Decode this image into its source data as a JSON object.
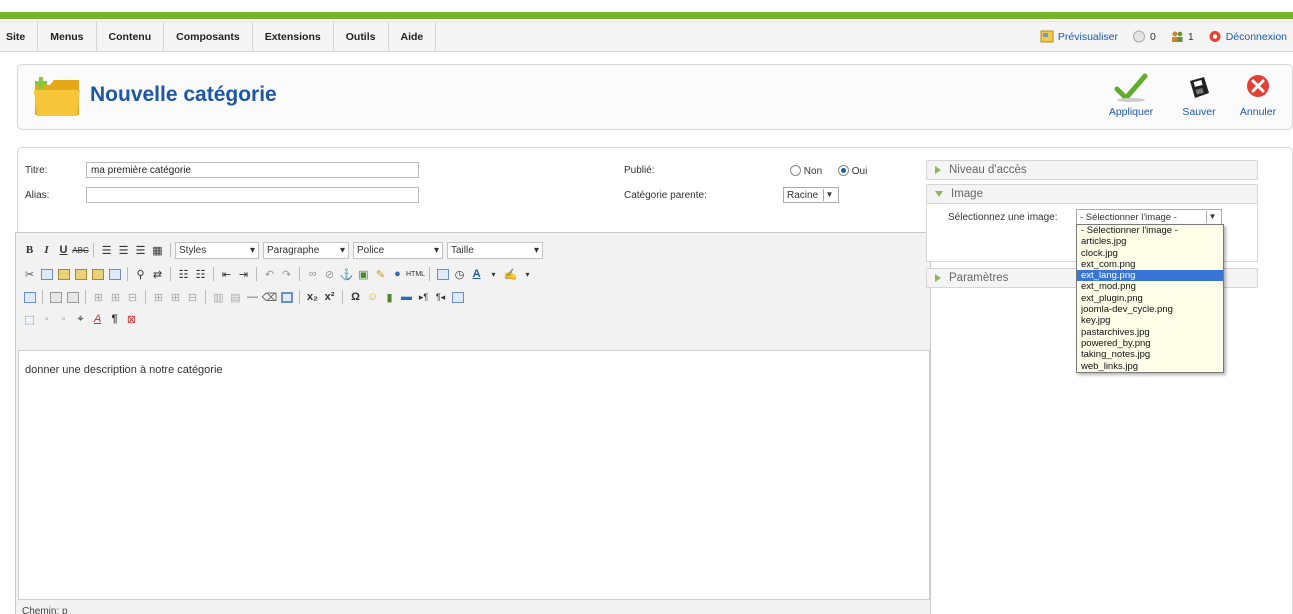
{
  "menubar": {
    "items": [
      "Site",
      "Menus",
      "Contenu",
      "Composants",
      "Extensions",
      "Outils",
      "Aide"
    ],
    "preview": "Prévisualiser",
    "messages_count": "0",
    "users_count": "1",
    "logout": "Déconnexion"
  },
  "header": {
    "title": "Nouvelle catégorie",
    "apply": "Appliquer",
    "save": "Sauver",
    "cancel": "Annuler"
  },
  "form": {
    "title_label": "Titre:",
    "title_value": "ma première catégorie",
    "alias_label": "Alias:",
    "alias_value": "",
    "published_label": "Publié:",
    "no_label": "Non",
    "yes_label": "Oui",
    "published": "Oui",
    "parent_label": "Catégorie parente:",
    "parent_value": "Racine"
  },
  "editor": {
    "styles": "Styles",
    "paragraph": "Paragraphe",
    "font": "Police",
    "size": "Taille",
    "content": "donner une description à notre catégorie",
    "path": "Chemin: p"
  },
  "sidebar": {
    "access": "Niveau d'accès",
    "image": "Image",
    "image_select_label": "Sélectionnez une image:",
    "image_select_value": "- Sélectionner l'image -",
    "params": "Paramètres",
    "image_options": [
      "- Sélectionner l'image -",
      "articles.jpg",
      "clock.jpg",
      "ext_com.png",
      "ext_lang.png",
      "ext_mod.png",
      "ext_plugin.png",
      "joomla-dev_cycle.png",
      "key.jpg",
      "pastarchives.jpg",
      "powered_by.png",
      "taking_notes.jpg",
      "web_links.jpg"
    ],
    "highlighted_option": "ext_lang.png"
  },
  "colors": {
    "brand_green": "#75b52a",
    "link_blue": "#1d57a4",
    "highlight": "#3875d7"
  }
}
